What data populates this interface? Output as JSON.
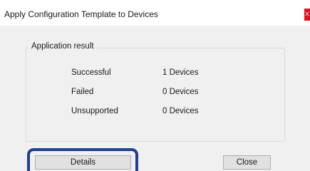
{
  "window": {
    "title": "Apply Configuration Template to Devices",
    "close_glyph": "x"
  },
  "result_group": {
    "legend": "Application result",
    "rows": [
      {
        "label": "Successful",
        "value": "1 Devices"
      },
      {
        "label": "Failed",
        "value": "0 Devices"
      },
      {
        "label": "Unsupported",
        "value": "0 Devices"
      }
    ]
  },
  "buttons": {
    "details_label": "Details",
    "close_label": "Close"
  },
  "colors": {
    "close_button_bg": "#e81123",
    "highlight_outline": "#1f3f91",
    "dialog_body_bg": "#f0f0f0"
  }
}
